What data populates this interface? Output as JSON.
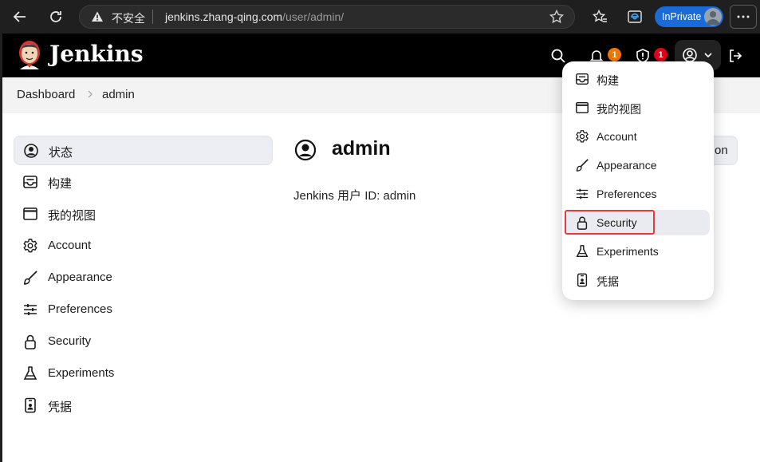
{
  "browser": {
    "insecure_label": "不安全",
    "url_host": "jenkins.zhang-qing.com",
    "url_path": "/user/admin/",
    "inprivate_label": "InPrivate"
  },
  "header": {
    "brand": "Jenkins",
    "notifications_count": "1",
    "security_count": "1",
    "notif_badge_color": "#f07800",
    "security_badge_color": "#e0001b"
  },
  "breadcrumb": {
    "items": [
      "Dashboard",
      "admin"
    ]
  },
  "sidebar": {
    "items": [
      {
        "label": "状态",
        "icon": "user-circle-icon"
      },
      {
        "label": "构建",
        "icon": "inbox-icon"
      },
      {
        "label": "我的视图",
        "icon": "window-icon"
      },
      {
        "label": "Account",
        "icon": "gear-icon"
      },
      {
        "label": "Appearance",
        "icon": "brush-icon"
      },
      {
        "label": "Preferences",
        "icon": "sliders-icon"
      },
      {
        "label": "Security",
        "icon": "lock-icon"
      },
      {
        "label": "Experiments",
        "icon": "flask-icon"
      },
      {
        "label": "凭据",
        "icon": "credentials-icon"
      }
    ]
  },
  "main": {
    "title": "admin",
    "user_id_text": "Jenkins 用户 ID: admin",
    "partial_button_text": "on"
  },
  "dropdown": {
    "items": [
      {
        "label": "构建",
        "icon": "inbox-icon"
      },
      {
        "label": "我的视图",
        "icon": "window-icon"
      },
      {
        "label": "Account",
        "icon": "gear-icon"
      },
      {
        "label": "Appearance",
        "icon": "brush-icon"
      },
      {
        "label": "Preferences",
        "icon": "sliders-icon"
      },
      {
        "label": "Security",
        "icon": "lock-icon"
      },
      {
        "label": "Experiments",
        "icon": "flask-icon"
      },
      {
        "label": "凭据",
        "icon": "credentials-icon"
      }
    ],
    "highlight_color": "#e23c3c"
  }
}
